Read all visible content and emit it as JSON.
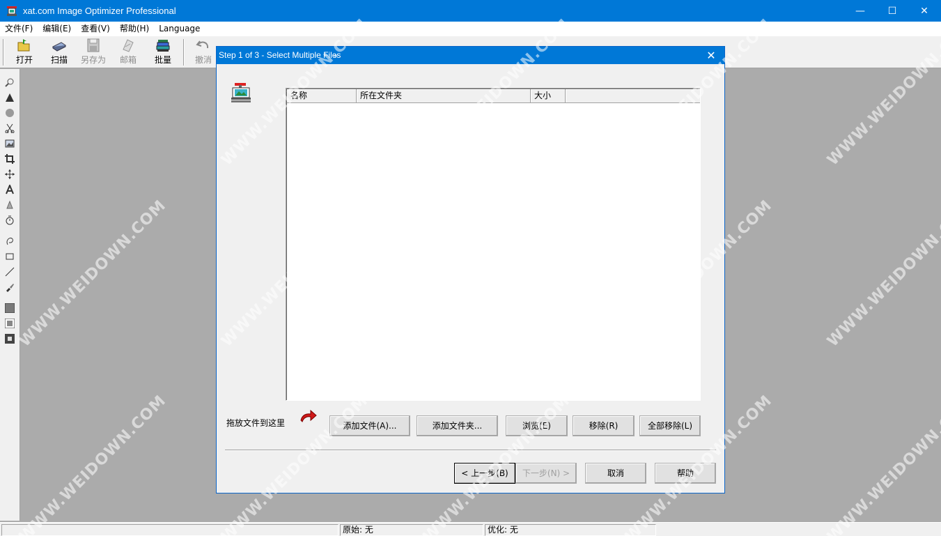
{
  "window": {
    "title": "xat.com  Image Optimizer Professional",
    "controls": {
      "minimize": "—",
      "maximize": "☐",
      "close": "✕"
    }
  },
  "menu": [
    "文件(F)",
    "编辑(E)",
    "查看(V)",
    "帮助(H)",
    "Language"
  ],
  "toolbar": {
    "open": "打开",
    "scan": "扫描",
    "save_as": "另存为",
    "mail": "邮箱",
    "batch": "批量",
    "undo": "撤消"
  },
  "statusbar": {
    "original": "原始: 无",
    "optimized": "优化: 无"
  },
  "dialog": {
    "title": "Step 1 of 3 - Select Multiple Files",
    "close": "✕",
    "columns": [
      "名称",
      "所在文件夹",
      "大小"
    ],
    "drop_label": "拖放文件到这里",
    "buttons": {
      "add_files": "添加文件(A)...",
      "add_folder": "添加文件夹...",
      "browse": "浏览(E)",
      "remove": "移除(R)",
      "remove_all": "全部移除(L)",
      "back": "< 上一步(B)",
      "next": "下一步(N) >",
      "cancel": "取消",
      "help": "帮助"
    }
  },
  "watermark": "WWW.WEIDOWN.COM",
  "colors": {
    "titlebar": "#0078d7",
    "workspace": "#ababab",
    "panel": "#f0f0f0"
  }
}
